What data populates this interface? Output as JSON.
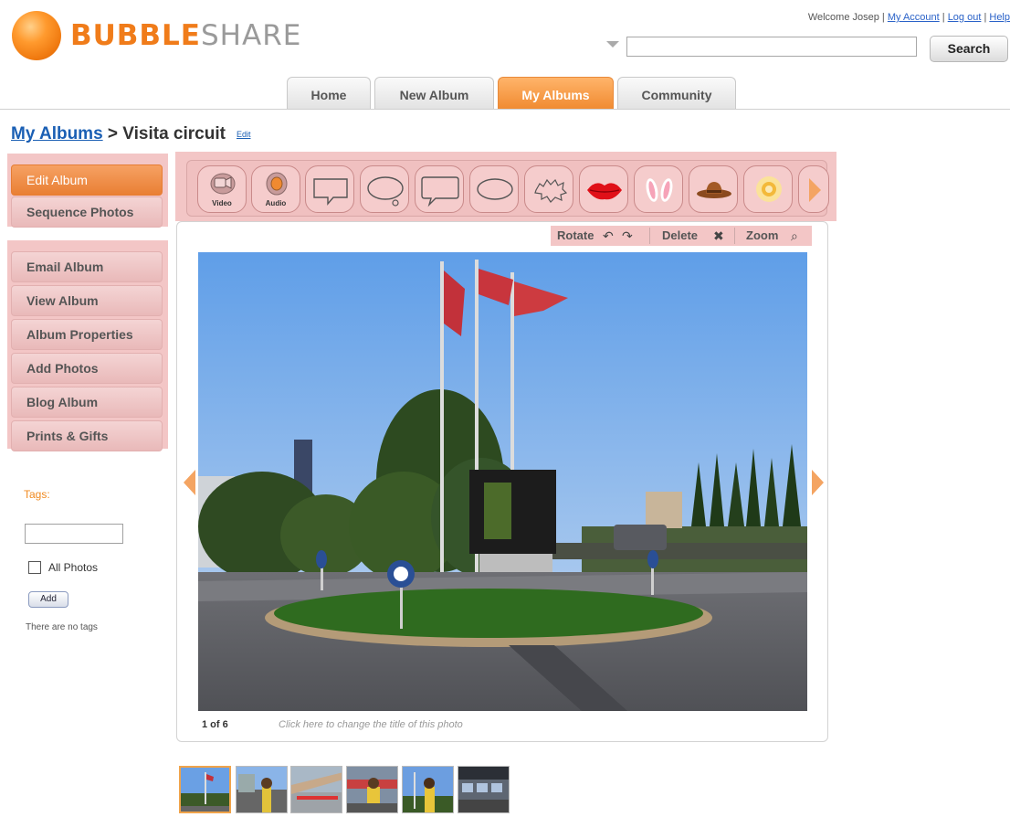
{
  "brand": {
    "name_bold": "BUBBLE",
    "name_light": "SHARE",
    "bubble_color": "#f58a1f"
  },
  "header": {
    "welcome_text": "Welcome Josep | ",
    "my_account": "My Account",
    "separator": " | ",
    "log_out": "Log out",
    "help": "Help",
    "search_value": "",
    "search_button": "Search"
  },
  "tabs": [
    {
      "label": "Home",
      "active": false
    },
    {
      "label": "New Album",
      "active": false
    },
    {
      "label": "My Albums",
      "active": true
    },
    {
      "label": "Community",
      "active": false
    }
  ],
  "breadcrumb": {
    "root": "My Albums",
    "separator": " > ",
    "current": "Visita circuit",
    "edit": "Edit"
  },
  "sidebar": {
    "top_items": [
      {
        "label": "Edit Album",
        "active": true
      },
      {
        "label": "Sequence Photos",
        "active": false
      }
    ],
    "items": [
      {
        "label": "Email Album"
      },
      {
        "label": "View Album"
      },
      {
        "label": "Album Properties"
      },
      {
        "label": "Add Photos"
      },
      {
        "label": "Blog Album"
      },
      {
        "label": "Prints & Gifts"
      }
    ],
    "tags": {
      "label": "Tags:",
      "input_value": "",
      "all_photos_label": "All Photos",
      "all_photos_checked": false,
      "add_button": "Add",
      "empty_text": "There are no tags"
    }
  },
  "stickers": [
    {
      "name": "video",
      "label": "Video"
    },
    {
      "name": "audio",
      "label": "Audio"
    },
    {
      "name": "speech-bubble-rect",
      "label": ""
    },
    {
      "name": "thought-bubble",
      "label": ""
    },
    {
      "name": "speech-bubble-left",
      "label": ""
    },
    {
      "name": "speech-bubble-oval",
      "label": ""
    },
    {
      "name": "burst-bubble",
      "label": ""
    },
    {
      "name": "lips",
      "label": ""
    },
    {
      "name": "bunny-ears",
      "label": ""
    },
    {
      "name": "cowboy-hat",
      "label": ""
    },
    {
      "name": "flower",
      "label": ""
    }
  ],
  "photo_tools": {
    "rotate": "Rotate",
    "delete": "Delete",
    "zoom": "Zoom"
  },
  "photo": {
    "index": 1,
    "total": 6,
    "counter_text": "1 of 6",
    "title_hint": "Click here to change the title of this photo"
  },
  "thumbnails": {
    "count": 6,
    "selected_index": 0
  },
  "colors": {
    "accent_orange": "#f08a30",
    "highlight_pink": "#f3c6c6",
    "link_blue": "#1a5fb4"
  }
}
